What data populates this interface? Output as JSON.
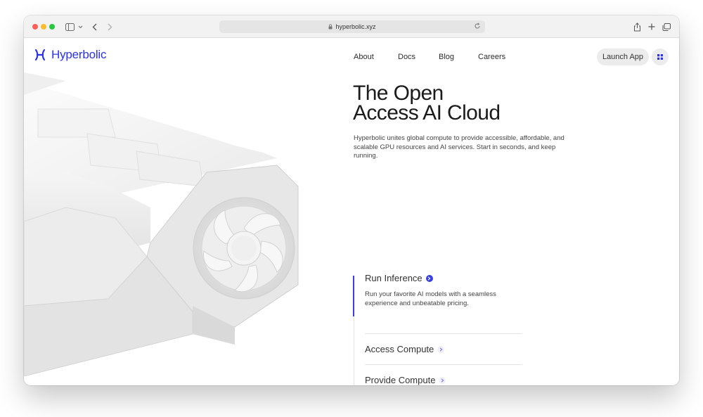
{
  "browser": {
    "url": "hyperbolic.xyz",
    "icons": [
      "sidebar-icon",
      "chevron-down-icon",
      "back-icon",
      "forward-icon",
      "lock-icon",
      "reload-icon",
      "share-icon",
      "new-tab-icon",
      "tabs-overview-icon"
    ]
  },
  "site": {
    "brand": "Hyperbolic",
    "brand_color": "#2c33e6",
    "nav": [
      "About",
      "Docs",
      "Blog",
      "Careers"
    ],
    "launch_label": "Launch App"
  },
  "hero": {
    "title_line1": "The Open",
    "title_line2": "Access AI Cloud",
    "description": "Hyperbolic unites global compute to provide accessible, affordable, and scalable GPU resources and AI services. Start in seconds, and keep running."
  },
  "features": [
    {
      "title": "Run Inference",
      "description": "Run your favorite AI models with a seamless experience and unbeatable pricing.",
      "active": true
    },
    {
      "title": "Access Compute",
      "active": false
    },
    {
      "title": "Provide Compute",
      "active": false
    }
  ],
  "accent_color": "#3a3fe0"
}
